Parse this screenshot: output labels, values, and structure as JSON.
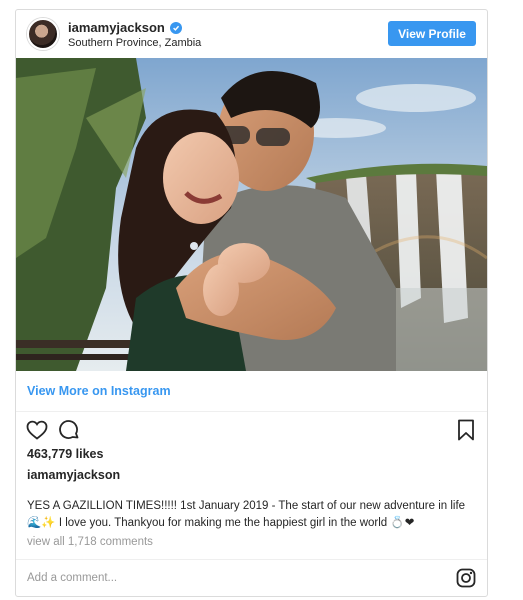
{
  "header": {
    "username": "iamamyjackson",
    "location": "Southern Province, Zambia",
    "view_profile_label": "View Profile",
    "verified_icon": "verified-badge-icon"
  },
  "post": {
    "photo_alt": "Couple embracing in front of a waterfall",
    "view_more_label": "View More on Instagram"
  },
  "actions": {
    "icons": [
      "heart-icon",
      "comment-icon",
      "bookmark-icon"
    ]
  },
  "likes": "463,779 likes",
  "author": "iamamyjackson",
  "caption": "YES A GAZILLION TIMES!!!!! 1st January 2019 - The start of our new adventure in life 🌊✨ I love you. Thankyou for making me the happiest girl in the world 💍❤",
  "comments_label": "view all 1,718 comments",
  "footer": {
    "add_comment_placeholder": "Add a comment...",
    "instagram_icon": "instagram-logo-icon"
  },
  "colors": {
    "accent": "#3897f0",
    "border": "#dbdbdb",
    "muted": "#999999"
  }
}
